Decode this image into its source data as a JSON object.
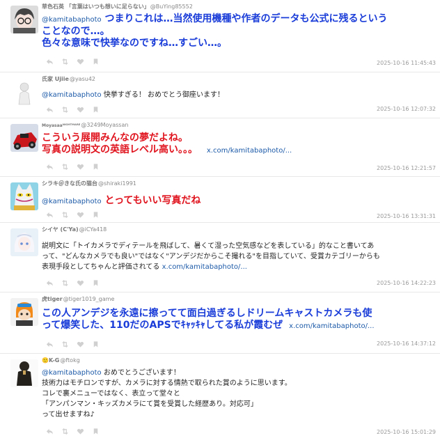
{
  "colors": {
    "mention": "#1c5aa8",
    "blue_text": "#1a3cd8",
    "red_text": "#e0141e",
    "timestamp": "#999999"
  },
  "tweets": [
    {
      "display_name": "草色石英 「言葉はいつも想いに足らない」",
      "username": "@BuYing85552",
      "mention": "@kamitabaphoto",
      "text_line1": "つまりこれは…当然使用機種や作者のデータも公式に残るという",
      "text_line2": "ことなので…。",
      "text_line3": "色々な意味で快挙なのですね…すごい…。",
      "timestamp": "2025-10-16 11:45:43"
    },
    {
      "display_name": "氏家 Ujiie",
      "username": "@yasu42",
      "mention": "@kamitabaphoto",
      "text": "快挙すぎる！ おめでとう御座います！",
      "timestamp": "2025-10-16 12:07:32"
    },
    {
      "display_name": "Moyasaaᴺᴵᴳᴴᵀᴹᴬᴿᴱ",
      "username": "@3249Moyassan",
      "text_line1": "こういう展開みんなの夢だよね。",
      "text_line2": "写真の説明文の英語レベル高い。。。",
      "link": "x.com/kamitabaphoto/...",
      "timestamp": "2025-10-16 12:21:57"
    },
    {
      "display_name": "シラキ＠きな氏の猫台",
      "username": "@shiraki1991",
      "mention": "@kamitabaphoto",
      "text": "とってもいい写真だね",
      "timestamp": "2025-10-16 13:31:31"
    },
    {
      "display_name": "シイヤ (C'Ya)",
      "username": "@iCYa418",
      "text_line1": "説明文に「トイカメラでディテールを飛ばして、暑くて湿った空気感などを表している」的なこと書いてあ",
      "text_line2": "って、\"どんなカメラでも良い\"ではなく\"アンデジだからこそ撮れる\"を目指していて、受賞カテゴリーからも",
      "text_line3": "表現手段としてちゃんと評価されてる",
      "link": "x.com/kamitabaphoto/...",
      "timestamp": "2025-10-16 14:22:23"
    },
    {
      "display_name": "虎tiger",
      "username": "@tiger1019_game",
      "text_line1": "この人アンデジを永遠に擦ってて面白過ぎるしドリームキャストカメラも使",
      "text_line2": "って爆笑した、110だのAPSでｷｬｯｷｬしてる私が霞むぜ",
      "link": "x.com/kamitabaphoto/...",
      "timestamp": "2025-10-16 14:37:12"
    },
    {
      "display_name": "🙂K-G",
      "username": "@ftokg",
      "mention": "@kamitabaphoto",
      "text_line1": "おめでとうございます！",
      "text_line2": "技術力はモチロンですが、カメラに対する情熱で取られた賞のように思います。",
      "text_line3": "コレで裏メニューではなく、表立って堂々と",
      "text_line4": "「アンパンマン・キッズカメラにて賞を受賞した経歴あり。対応可」",
      "text_line5": "って出せますね♪",
      "timestamp": "2025-10-16 15:01:29"
    }
  ],
  "action_icons": [
    "reply-icon",
    "retweet-icon",
    "like-icon",
    "bookmark-icon"
  ]
}
